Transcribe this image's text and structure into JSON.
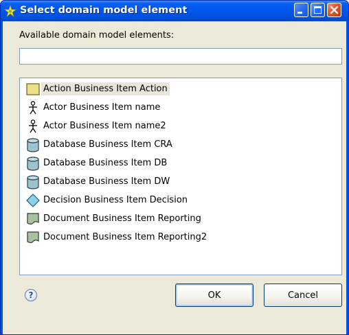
{
  "window": {
    "title": "Select domain model element"
  },
  "dialog": {
    "label": "Available domain model elements:",
    "search_value": ""
  },
  "list": {
    "items": [
      {
        "label": "Action Business Item Action",
        "icon": "action-icon",
        "selected": true
      },
      {
        "label": "Actor Business Item name",
        "icon": "actor-icon",
        "selected": false
      },
      {
        "label": "Actor Business Item name2",
        "icon": "actor-icon",
        "selected": false
      },
      {
        "label": "Database Business Item CRA",
        "icon": "database-icon",
        "selected": false
      },
      {
        "label": "Database Business Item DB",
        "icon": "database-icon",
        "selected": false
      },
      {
        "label": "Database Business Item DW",
        "icon": "database-icon",
        "selected": false
      },
      {
        "label": "Decision Business Item Decision",
        "icon": "decision-icon",
        "selected": false
      },
      {
        "label": "Document Business Item Reporting",
        "icon": "document-icon",
        "selected": false
      },
      {
        "label": "Document Business Item Reporting2",
        "icon": "document-icon",
        "selected": false
      }
    ]
  },
  "buttons": {
    "help": "?",
    "ok": "OK",
    "cancel": "Cancel"
  },
  "colors": {
    "titlebar": "#0058ee",
    "client": "#ece9d8",
    "selection": "#e8e6dc"
  }
}
